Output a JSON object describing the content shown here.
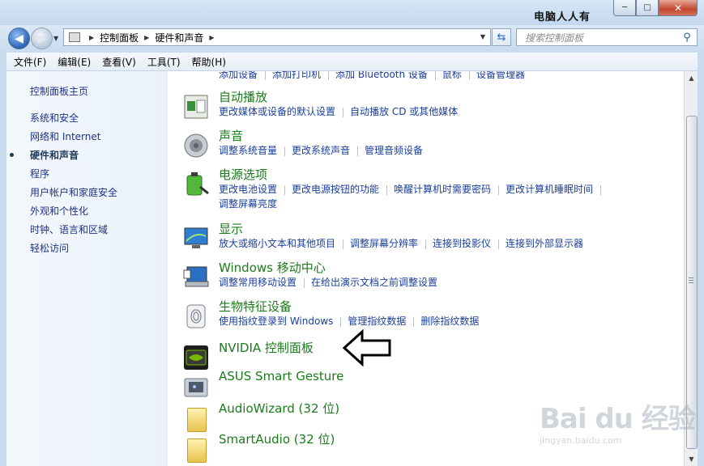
{
  "watermark_title": "电脑人人有",
  "window_buttons": {
    "minimize": "─",
    "maximize": "□",
    "close": "✕"
  },
  "address": {
    "crumbs": [
      "控制面板",
      "硬件和声音"
    ]
  },
  "search": {
    "placeholder": "搜索控制面板"
  },
  "menu": [
    "文件(F)",
    "编辑(E)",
    "查看(V)",
    "工具(T)",
    "帮助(H)"
  ],
  "sidebar": {
    "items": [
      "控制面板主页",
      "系统和安全",
      "网络和 Internet",
      "硬件和声音",
      "程序",
      "用户帐户和家庭安全",
      "外观和个性化",
      "时钟、语言和区域",
      "轻松访问"
    ],
    "active_index": 3
  },
  "partial_top_links": [
    "添加设备",
    "添加打印机",
    "添加 Bluetooth 设备",
    "鼠标",
    "设备管理器"
  ],
  "categories": [
    {
      "title": "自动播放",
      "links": [
        "更改媒体或设备的默认设置",
        "自动播放 CD 或其他媒体"
      ],
      "icon": "autoplay-icon"
    },
    {
      "title": "声音",
      "links": [
        "调整系统音量",
        "更改系统声音",
        "管理音频设备"
      ],
      "icon": "speaker-icon"
    },
    {
      "title": "电源选项",
      "links": [
        "更改电池设置",
        "更改电源按钮的功能",
        "唤醒计算机时需要密码",
        "更改计算机睡眠时间",
        "调整屏幕亮度"
      ],
      "icon": "battery-icon"
    },
    {
      "title": "显示",
      "links": [
        "放大或缩小文本和其他项目",
        "调整屏幕分辨率",
        "连接到投影仪",
        "连接到外部显示器"
      ],
      "icon": "monitor-icon"
    },
    {
      "title": "Windows 移动中心",
      "links": [
        "调整常用移动设置",
        "在给出演示文档之前调整设置"
      ],
      "icon": "mobility-center-icon"
    },
    {
      "title": "生物特征设备",
      "links": [
        "使用指纹登录到 Windows",
        "管理指纹数据",
        "删除指纹数据"
      ],
      "icon": "fingerprint-icon"
    },
    {
      "title": "NVIDIA 控制面板",
      "links": [],
      "icon": "nvidia-icon"
    },
    {
      "title": "ASUS Smart Gesture",
      "links": [],
      "icon": "touchpad-icon"
    },
    {
      "title": "AudioWizard (32 位)",
      "links": [],
      "icon": "folder-icon"
    },
    {
      "title": "SmartAudio (32 位)",
      "links": [],
      "icon": "folder-icon"
    }
  ],
  "watermark": {
    "logo": "Bai du 经验",
    "url": "jingyan.baidu.com"
  }
}
